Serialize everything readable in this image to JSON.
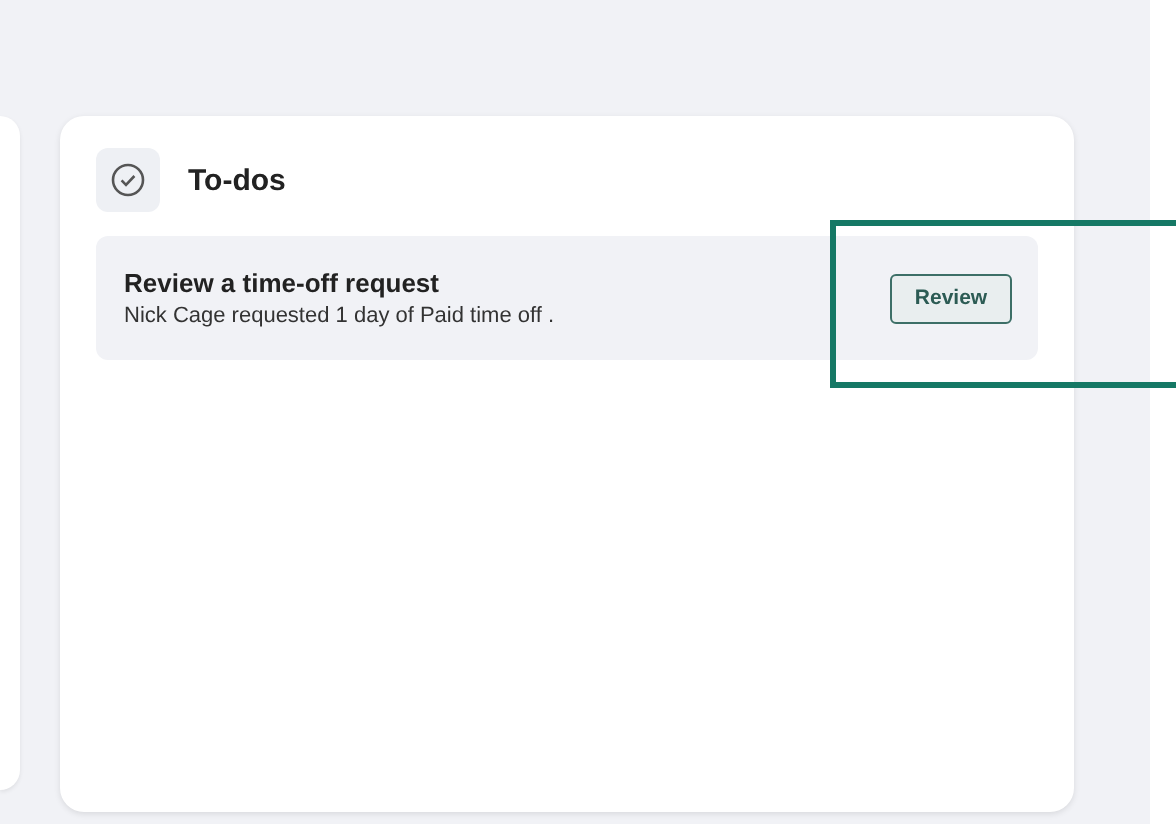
{
  "todos": {
    "title": "To-dos",
    "items": [
      {
        "title": "Review a time-off request",
        "description": "Nick Cage requested 1 day of Paid time off .",
        "action": "Review"
      }
    ]
  }
}
